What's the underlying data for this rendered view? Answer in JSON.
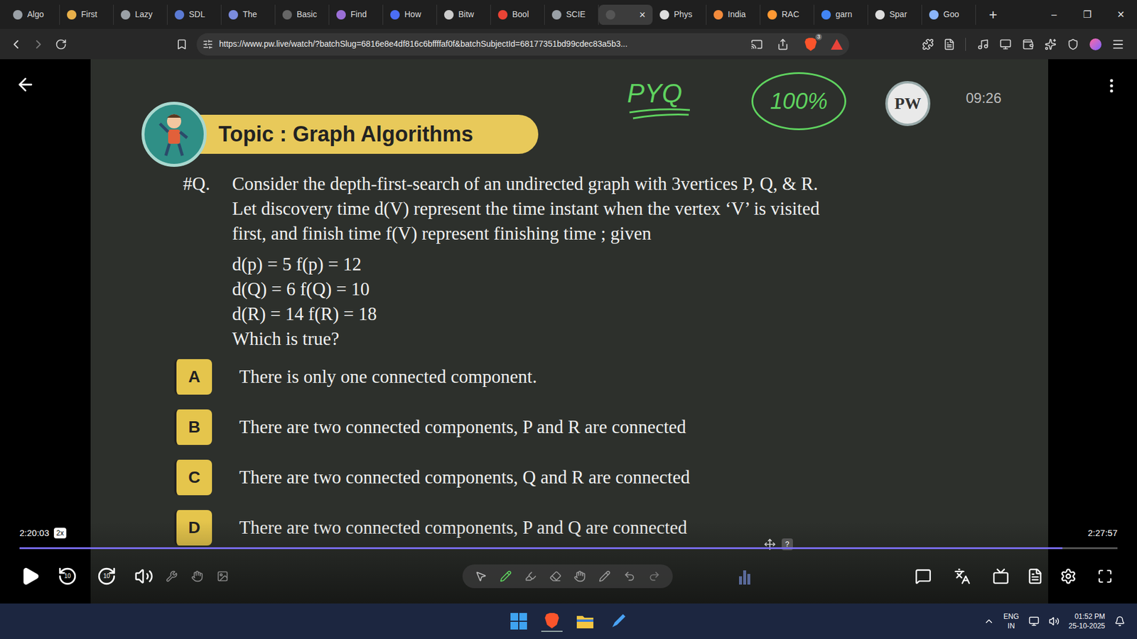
{
  "browser": {
    "tabs": [
      {
        "label": "Algo",
        "selected": false,
        "color": "#9aa0a6"
      },
      {
        "label": "First",
        "selected": false,
        "color": "#e8b04a"
      },
      {
        "label": "Lazy",
        "selected": false,
        "color": "#9aa0a6"
      },
      {
        "label": "SDL",
        "selected": false,
        "color": "#5b7bd5"
      },
      {
        "label": "The",
        "selected": false,
        "color": "#7b8cde"
      },
      {
        "label": "Basic",
        "selected": false,
        "color": "#666666"
      },
      {
        "label": "Find",
        "selected": false,
        "color": "#9b6fd6"
      },
      {
        "label": "How",
        "selected": false,
        "color": "#4b6ef5"
      },
      {
        "label": "Bitw",
        "selected": false,
        "color": "#cccccc"
      },
      {
        "label": "Bool",
        "selected": false,
        "color": "#ea4335"
      },
      {
        "label": "SCIE",
        "selected": false,
        "color": "#9aa0a6"
      },
      {
        "label": "",
        "selected": true,
        "color": "#555555"
      },
      {
        "label": "Phys",
        "selected": false,
        "color": "#dddddd"
      },
      {
        "label": "India",
        "selected": false,
        "color": "#f28b3c"
      },
      {
        "label": "RAC",
        "selected": false,
        "color": "#ff9933"
      },
      {
        "label": "garn",
        "selected": false,
        "color": "#4285f4"
      },
      {
        "label": "Spar",
        "selected": false,
        "color": "#dddddd"
      },
      {
        "label": "Goo",
        "selected": false,
        "color": "#8ab4f8"
      }
    ],
    "tab_close": "×",
    "new_tab": "+",
    "window_controls": [
      "–",
      "❐",
      "✕"
    ],
    "address_bar": {
      "url": "https://www.pw.live/watch/?batchSlug=6816e8e4df816c6bffffaf0f&batchSubjectId=68177351bd99cdec83a5b3...",
      "shield_count": "3"
    }
  },
  "slide": {
    "topic": "Topic : Graph Algorithms",
    "annotations": {
      "tag": "PYQ",
      "score": "100%"
    },
    "logo": "PW",
    "clock": "09:26",
    "question": {
      "number": "#Q.",
      "lines": [
        "Consider the depth-first-search of an undirected graph with 3vertices P, Q, & R.",
        "Let discovery time d(V) represent the time instant when the vertex ‘V’ is visited",
        "first, and finish time f(V) represent finishing time ; given"
      ],
      "given": [
        "d(p) = 5 f(p) = 12",
        "d(Q) = 6 f(Q) = 10",
        "d(R) = 14 f(R) = 18"
      ],
      "prompt": "Which is true?"
    },
    "options": [
      {
        "letter": "A",
        "text": "There is only one connected component."
      },
      {
        "letter": "B",
        "text": "There are two connected components, P and R are connected"
      },
      {
        "letter": "C",
        "text": "There are two connected components, Q and R are connected"
      },
      {
        "letter": "D",
        "text": "There are two connected components, P and Q are connected"
      }
    ]
  },
  "player": {
    "current_time": "2:20:03",
    "speed": "2x",
    "duration": "2:27:57",
    "progress": {
      "level": 0.95
    },
    "skip_back": "10",
    "skip_forward": "10",
    "help": "?"
  },
  "taskbar": {
    "language": "ENG",
    "region": "IN",
    "time": "01:52 PM",
    "date": "25-10-2025"
  }
}
